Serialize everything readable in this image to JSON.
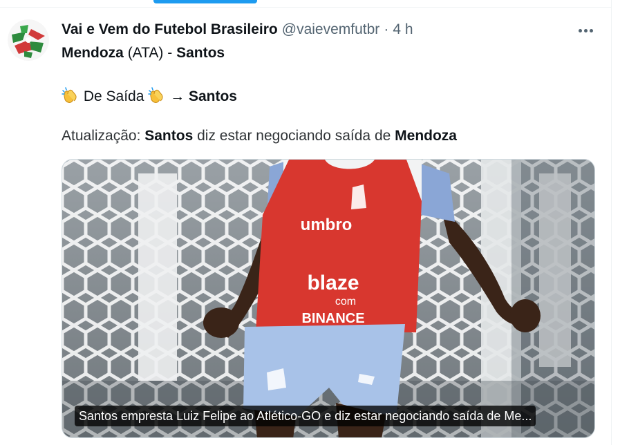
{
  "tweet": {
    "display_name": "Vai e Vem do Futebol Brasileiro",
    "handle": "@vaievemfutbr",
    "separator": "·",
    "time": "4 h",
    "line1": {
      "player": "Mendoza",
      "position": "(ATA)",
      "dash": "-",
      "club": "Santos"
    },
    "line2": {
      "label": "De Saída",
      "arrow": "→",
      "club": "Santos"
    },
    "line3": {
      "prefix": "Atualização:",
      "club": "Santos",
      "middle": "diz estar negociando saída de",
      "player": "Mendoza"
    },
    "media_caption": "Santos empresta Luiz Felipe ao Atlético-GO e diz estar negociando saída de Me..."
  },
  "jersey": {
    "sponsor_main": "blaze",
    "sponsor_sub": "com",
    "sponsor_bottom": "BINANCE",
    "brand": "umbro"
  },
  "icons": {
    "avatar": "vai-e-vem-logo-icon",
    "more": "more-options-icon",
    "clap": "clapping-hands-emoji"
  },
  "colors": {
    "accent": "#1d9bf0",
    "text": "#0f1419",
    "muted": "#536471",
    "bib": "#d8372f"
  }
}
